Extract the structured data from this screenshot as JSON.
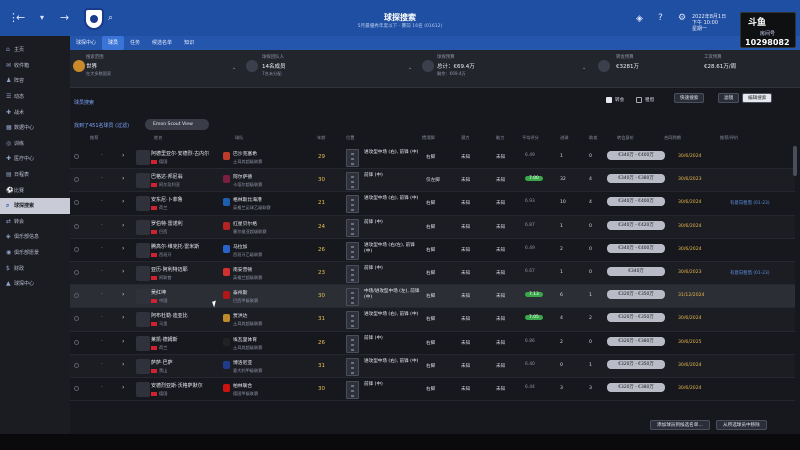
{
  "header": {
    "title": "球探搜索",
    "subtitle": "5月最優秀年度以下 · 賽前 16名 (01612)",
    "date_line1": "2022年8月1日",
    "date_line2": "下午 10:00",
    "date_line3": "星期一"
  },
  "stream": {
    "logo": "斗鱼",
    "name": "房间号",
    "number": "10298082"
  },
  "subnav": {
    "tabs": [
      "球探中心",
      "球员",
      "任务",
      "候选名单",
      "知识"
    ],
    "active_index": 1
  },
  "sidebar": {
    "items": [
      {
        "label": "主页",
        "icon": "home-icon"
      },
      {
        "label": "收件箱",
        "icon": "inbox-icon"
      },
      {
        "label": "阵容",
        "icon": "squad-icon"
      },
      {
        "label": "动态",
        "icon": "news-icon"
      },
      {
        "label": "战术",
        "icon": "tactics-icon"
      },
      {
        "label": "数据中心",
        "icon": "data-icon"
      },
      {
        "label": "训练",
        "icon": "training-icon"
      },
      {
        "label": "医疗中心",
        "icon": "medical-icon"
      },
      {
        "label": "日程表",
        "icon": "calendar-icon"
      },
      {
        "label": "比赛",
        "icon": "match-icon"
      },
      {
        "label": "球探搜索",
        "icon": "scout-icon",
        "active": true
      },
      {
        "label": "转会",
        "icon": "transfer-icon"
      },
      {
        "label": "俱乐部信息",
        "icon": "club-icon"
      },
      {
        "label": "俱乐部愿景",
        "icon": "vision-icon"
      },
      {
        "label": "财政",
        "icon": "finance-icon"
      },
      {
        "label": "球探中心",
        "icon": "scouting-icon"
      }
    ]
  },
  "infobar": {
    "items": [
      {
        "label": "搜索范围",
        "value": "世界",
        "sub": "在大多数国家"
      },
      {
        "label": "球探团队人",
        "value": "14名成员",
        "sub": "7名未分配"
      },
      {
        "label": "球探预算",
        "value": "总计：€69.4万",
        "sub": "剩余：€69.4万"
      },
      {
        "label": "转会预算",
        "value": "€3281万",
        "sub": ""
      },
      {
        "label": "工资预算",
        "value": "€28.61万/周",
        "sub": ""
      }
    ]
  },
  "filterbar": {
    "title": "球员搜索",
    "toggle1": "转会",
    "toggle2": "租借",
    "quick_search": "快速搜索",
    "filter": "滤镜",
    "edit_search": "编辑搜索"
  },
  "results": {
    "count_text": "找到了451名球员 (过滤)",
    "scout_view": "Emon Scout View"
  },
  "table": {
    "headers": [
      "推荐",
      "ID",
      "姓名",
      "球队",
      "年龄",
      "位置",
      "惯用脚",
      "潜力",
      "能力",
      "平均评分",
      "进球",
      "助攻",
      "转会身价",
      "合同到期",
      "推荐/评价"
    ],
    "rows": [
      {
        "name": "阿德里亚尔·安德烈·古内尔",
        "nat": "德国",
        "club": "巴沙克塞希",
        "league": "土耳其超级联赛",
        "age": "29",
        "pos": "进攻型中场 (右), 前锋 (中)",
        "pos2": "",
        "foot": "右脚",
        "pot": "未知",
        "abil": "未知",
        "rating": "6.49",
        "g": "1",
        "a": "0",
        "fee": "€340万 - €400万",
        "exp": "30/6/2024",
        "note": ""
      },
      {
        "name": "巴格达·邦尼翁",
        "nat": "阿尔及利亚",
        "club": "阿尔萨德",
        "league": "卡塔尔超级联赛",
        "age": "30",
        "pos": "前锋 (中)",
        "pos2": "",
        "foot": "仅左脚",
        "pot": "未知",
        "abil": "未知",
        "rating": "7.00",
        "g": "32",
        "a": "4",
        "fee": "€340万 - €380万",
        "exp": "30/6/2023",
        "note": ""
      },
      {
        "name": "安东尼·卜菲鲁",
        "nat": "荷兰",
        "club": "格林斯比海港",
        "league": "英格兰足球乙级联赛",
        "age": "21",
        "pos": "进攻型中场 (右), 前锋 (中)",
        "pos2": "",
        "foot": "右脚",
        "pot": "未知",
        "abil": "未知",
        "rating": "6.93",
        "g": "10",
        "a": "4",
        "fee": "€340万 - €400万",
        "exp": "30/6/2024",
        "note": "有意向租借 (01-23)"
      },
      {
        "name": "罗伯特·雷诺利",
        "nat": "巴西",
        "club": "红星贝尔格",
        "league": "塞尔维亚超级联赛",
        "age": "24",
        "pos": "前锋 (中)",
        "pos2": "",
        "foot": "右脚",
        "pot": "未知",
        "abil": "未知",
        "rating": "6.87",
        "g": "1",
        "a": "0",
        "fee": "€340万 - €420万",
        "exp": "30/6/2024",
        "note": ""
      },
      {
        "name": "腾高尔·维克托·雷米斯",
        "nat": "西班牙",
        "club": "马拉加",
        "league": "西班牙乙级联赛",
        "age": "26",
        "pos": "进攻型中场 (右/左), 前锋 (中)",
        "pos2": "",
        "foot": "右脚",
        "pot": "未知",
        "abil": "未知",
        "rating": "6.49",
        "g": "2",
        "a": "0",
        "fee": "€340万 - €400万",
        "exp": "30/6/2024",
        "note": ""
      },
      {
        "name": "亚历·阿利特迈耶",
        "nat": "阿联酋",
        "club": "南安普顿",
        "league": "英格兰超级联赛",
        "age": "23",
        "pos": "前锋 (中)",
        "pos2": "",
        "foot": "右脚",
        "pot": "未知",
        "abil": "未知",
        "rating": "6.67",
        "g": "1",
        "a": "0",
        "fee": "€340万",
        "exp": "30/6/2023",
        "note": "有意向租借 (01-23)"
      },
      {
        "name": "吴红坤",
        "nat": "中国",
        "club": "泰州斯",
        "league": "巴西甲级联赛",
        "age": "30",
        "pos": "中场/进攻型中场 (左), 前锋 (中)",
        "pos2": "",
        "foot": "右脚",
        "pot": "未知",
        "abil": "未知",
        "rating": "7.13",
        "g": "6",
        "a": "1",
        "fee": "€320万 - €350万",
        "exp": "31/12/2024",
        "note": ""
      },
      {
        "name": "阿布杜勒·迪亚比",
        "nat": "马里",
        "club": "贾洪达",
        "league": "土耳其超级联赛",
        "age": "31",
        "pos": "进攻型中场 (右), 前锋 (中)",
        "pos2": "",
        "foot": "右脚",
        "pot": "未知",
        "abil": "未知",
        "rating": "7.05",
        "g": "4",
        "a": "2",
        "fee": "€320万 - €350万",
        "exp": "30/6/2024",
        "note": ""
      },
      {
        "name": "莱凯·德姆斯",
        "nat": "荷兰",
        "club": "埃瓦里体育",
        "league": "土耳其超级联赛",
        "age": "26",
        "pos": "前锋 (中)",
        "pos2": "",
        "foot": "右脚",
        "pot": "未知",
        "abil": "未知",
        "rating": "6.86",
        "g": "2",
        "a": "0",
        "fee": "€320万 - €380万",
        "exp": "30/6/2025",
        "note": ""
      },
      {
        "name": "萨萨·巴萨",
        "nat": "黑山",
        "club": "博洛尼亚",
        "league": "意大利甲级联赛",
        "age": "31",
        "pos": "进攻型中场 (右), 前锋 (中)",
        "pos2": "",
        "foot": "右脚",
        "pot": "未知",
        "abil": "未知",
        "rating": "6.40",
        "g": "0",
        "a": "1",
        "fee": "€320万 - €350万",
        "exp": "30/6/2024",
        "note": ""
      },
      {
        "name": "安德烈亚斯·沃格萨默尔",
        "nat": "德国",
        "club": "柏林联合",
        "league": "德国甲级联赛",
        "age": "30",
        "pos": "前锋 (中)",
        "pos2": "",
        "foot": "右脚",
        "pot": "未知",
        "abil": "未知",
        "rating": "6.44",
        "g": "3",
        "a": "3",
        "fee": "€320万 - €380万",
        "exp": "30/6/2024",
        "note": ""
      }
    ]
  },
  "footer": {
    "btn1": "添加球员到候选名单...",
    "btn2": "从所选球员中移除"
  },
  "colors": {
    "accent": "#1f4fa2",
    "gold": "#e8b84d",
    "green": "#3aa84a"
  }
}
